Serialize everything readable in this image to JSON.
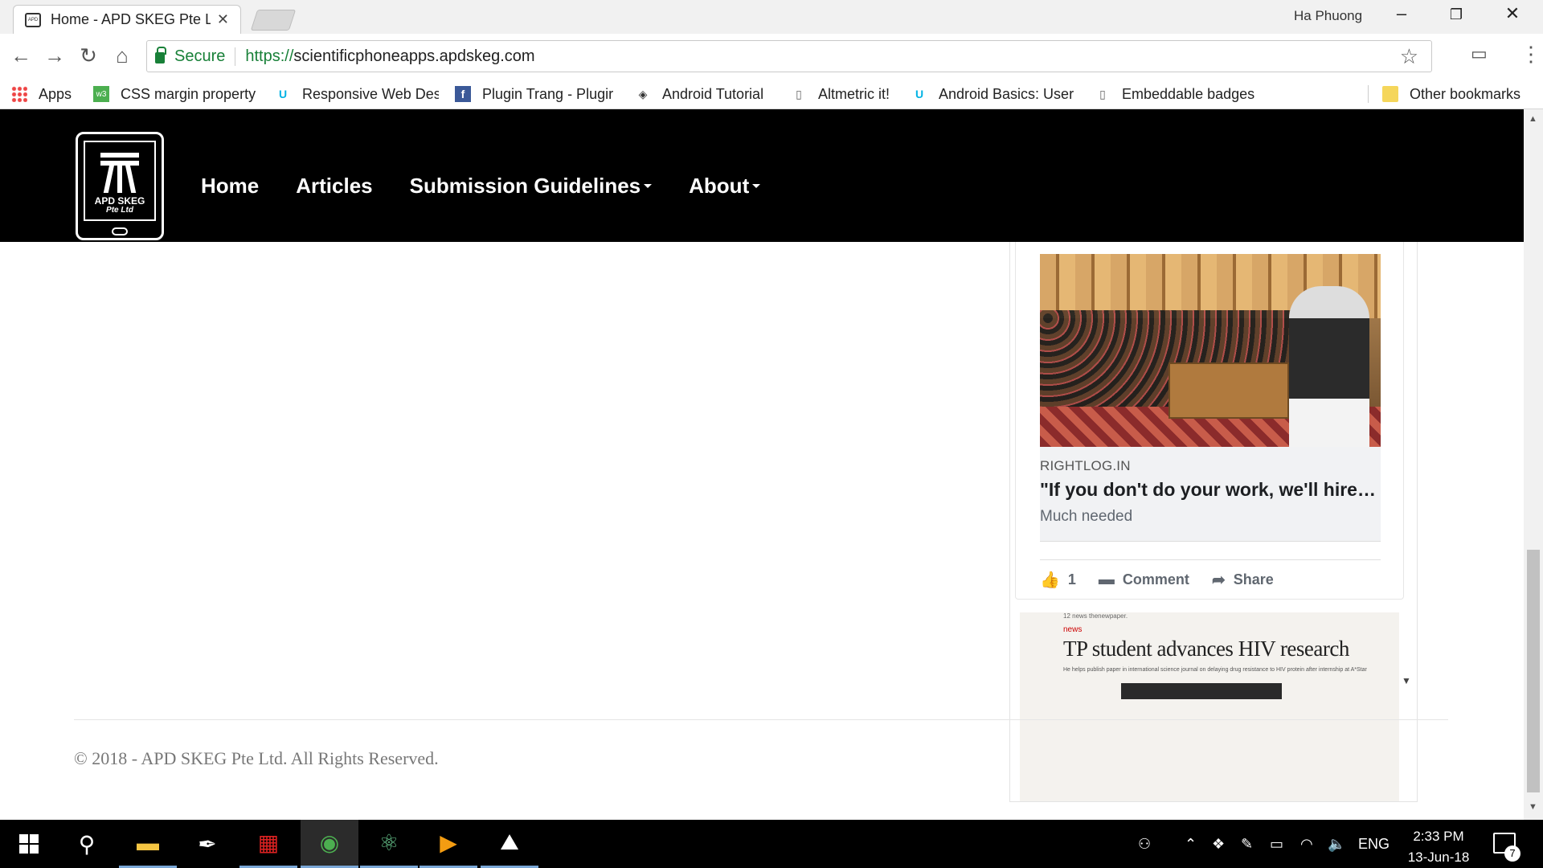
{
  "browser": {
    "tab_title": "Home - APD SKEG Pte Ltd",
    "profile_name": "Ha Phuong",
    "secure_label": "Secure",
    "url_scheme": "https://",
    "url_host": "scientificphoneapps.apdskeg.com",
    "bookmarks": [
      {
        "label": "Apps",
        "icon": "apps-grid-icon"
      },
      {
        "label": "CSS margin property",
        "icon": "w3schools-icon"
      },
      {
        "label": "Responsive Web Des",
        "icon": "udacity-icon"
      },
      {
        "label": "Plugin Trang - Plugir",
        "icon": "facebook-icon"
      },
      {
        "label": "Android Tutorial",
        "icon": "tutorialspoint-icon"
      },
      {
        "label": "Altmetric it!",
        "icon": "page-icon"
      },
      {
        "label": "Android Basics: User",
        "icon": "udacity-icon"
      },
      {
        "label": "Embeddable badges",
        "icon": "page-icon"
      }
    ],
    "other_bookmarks": "Other bookmarks"
  },
  "site": {
    "logo_text": "APD SKEG",
    "logo_sub": "Pte Ltd",
    "nav": [
      "Home",
      "Articles",
      "Submission Guidelines",
      "About"
    ]
  },
  "embed": {
    "source": "RIGHTLOG.IN",
    "title": "\"If you don't do your work, we'll hire someone else\"",
    "description": "Much needed",
    "like_count": "1",
    "comment_label": "Comment",
    "share_label": "Share",
    "news_paper_top": "12  news  thenewpaper.",
    "news_tag": "news",
    "news_headline": "TP student advances HIV research",
    "news_deck": "He helps publish paper in international science journal on delaying drug resistance to HIV protein after internship at A*Star"
  },
  "footer": {
    "copyright": "© 2018 - APD SKEG Pte Ltd. All Rights Reserved."
  },
  "taskbar": {
    "language": "ENG",
    "time": "2:33 PM",
    "date": "13-Jun-18",
    "notification_count": "7"
  }
}
